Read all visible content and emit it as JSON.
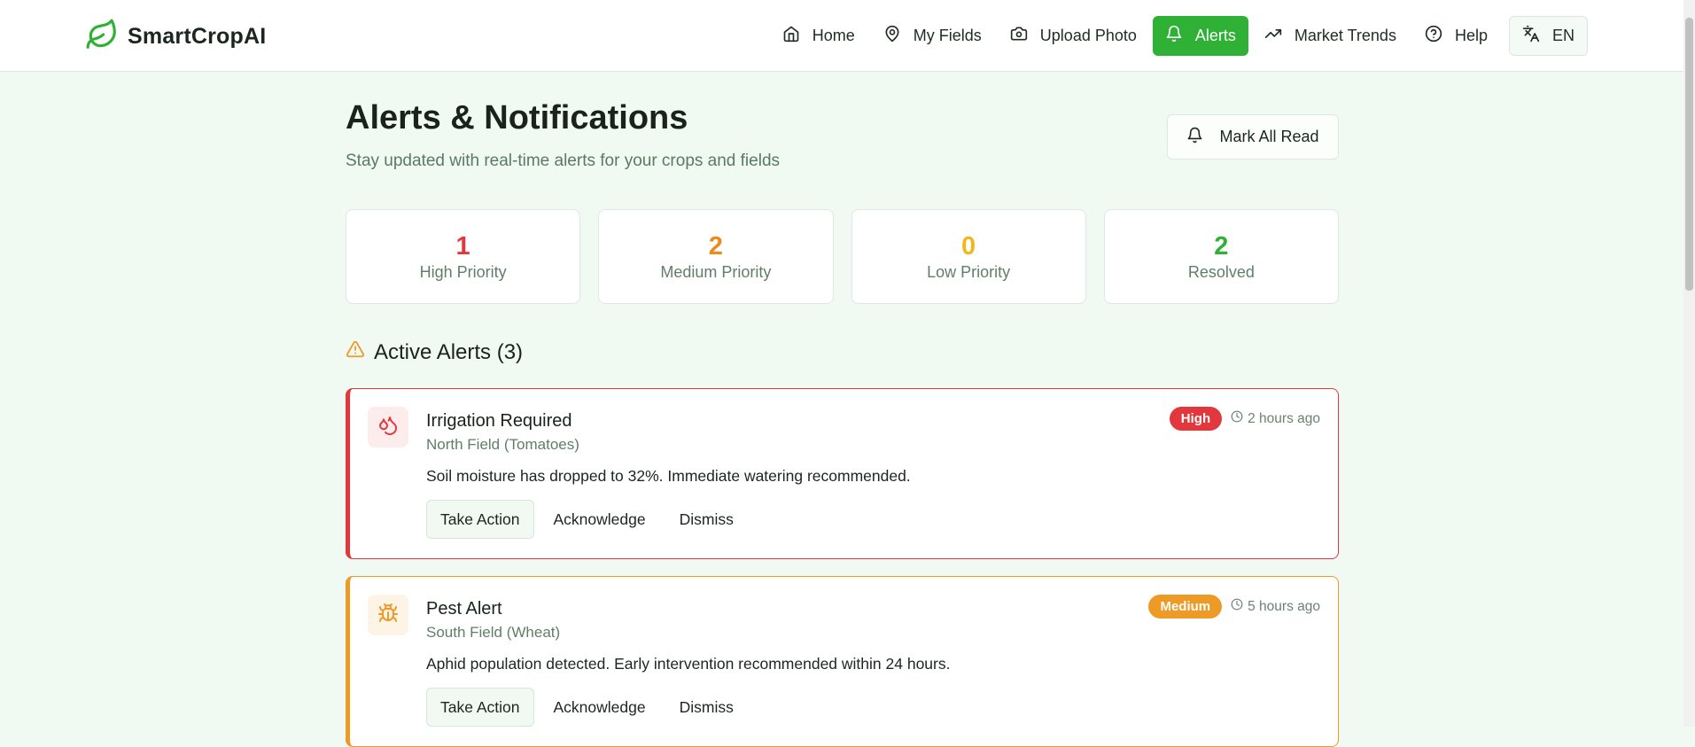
{
  "brand": {
    "name": "SmartCropAI"
  },
  "nav": {
    "home": "Home",
    "fields": "My Fields",
    "upload": "Upload Photo",
    "alerts": "Alerts",
    "market": "Market Trends",
    "help": "Help",
    "lang": "EN"
  },
  "page": {
    "title": "Alerts & Notifications",
    "subtitle": "Stay updated with real-time alerts for your crops and fields",
    "mark_all_read": "Mark All Read"
  },
  "stats": [
    {
      "value": "1",
      "label": "High Priority",
      "color": "#e3373e"
    },
    {
      "value": "2",
      "label": "Medium Priority",
      "color": "#ee8a1a"
    },
    {
      "value": "0",
      "label": "Low Priority",
      "color": "#f0b81c"
    },
    {
      "value": "2",
      "label": "Resolved",
      "color": "#2eb135"
    }
  ],
  "active": {
    "title": "Active Alerts (3)"
  },
  "alerts": [
    {
      "title": "Irrigation Required",
      "field": "North Field (Tomatoes)",
      "message": "Soil moisture has dropped to 32%. Immediate watering recommended.",
      "priority": "High",
      "time": "2 hours ago",
      "icon": "droplets-icon",
      "color": "#e3373e",
      "actions": {
        "take": "Take Action",
        "ack": "Acknowledge",
        "dismiss": "Dismiss"
      }
    },
    {
      "title": "Pest Alert",
      "field": "South Field (Wheat)",
      "message": "Aphid population detected. Early intervention recommended within 24 hours.",
      "priority": "Medium",
      "time": "5 hours ago",
      "icon": "bug-icon",
      "color": "#ee9a26",
      "actions": {
        "take": "Take Action",
        "ack": "Acknowledge",
        "dismiss": "Dismiss"
      }
    }
  ]
}
